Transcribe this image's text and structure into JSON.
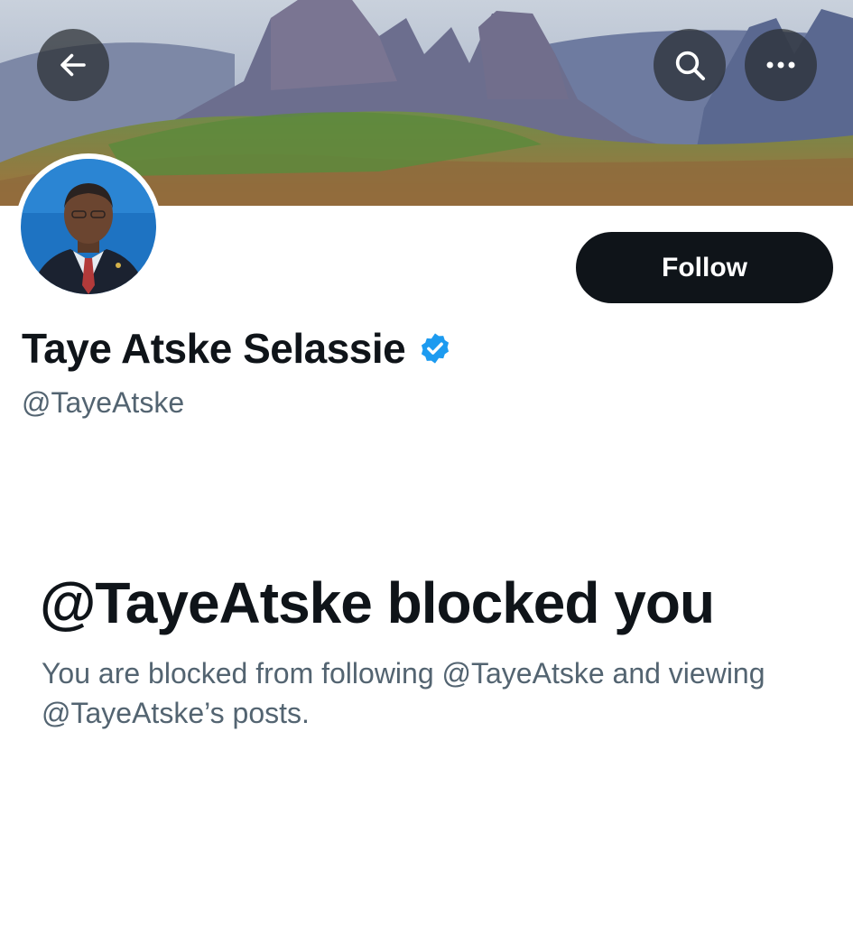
{
  "header": {
    "back_icon": "arrow-left-icon",
    "search_icon": "search-icon",
    "more_icon": "more-horizontal-icon"
  },
  "profile": {
    "display_name": "Taye Atske Selassie",
    "handle": "@TayeAtske",
    "verified_icon": "verified-badge-icon",
    "verified_color": "#1d9bf0",
    "follow_label": "Follow"
  },
  "blocked": {
    "title": "@TayeAtske blocked you",
    "message": "You are blocked from following @TayeAtske and viewing @TayeAtske’s posts."
  },
  "colors": {
    "primary_text": "#0f1419",
    "secondary_text": "#536471",
    "button_bg": "#0f1419"
  }
}
